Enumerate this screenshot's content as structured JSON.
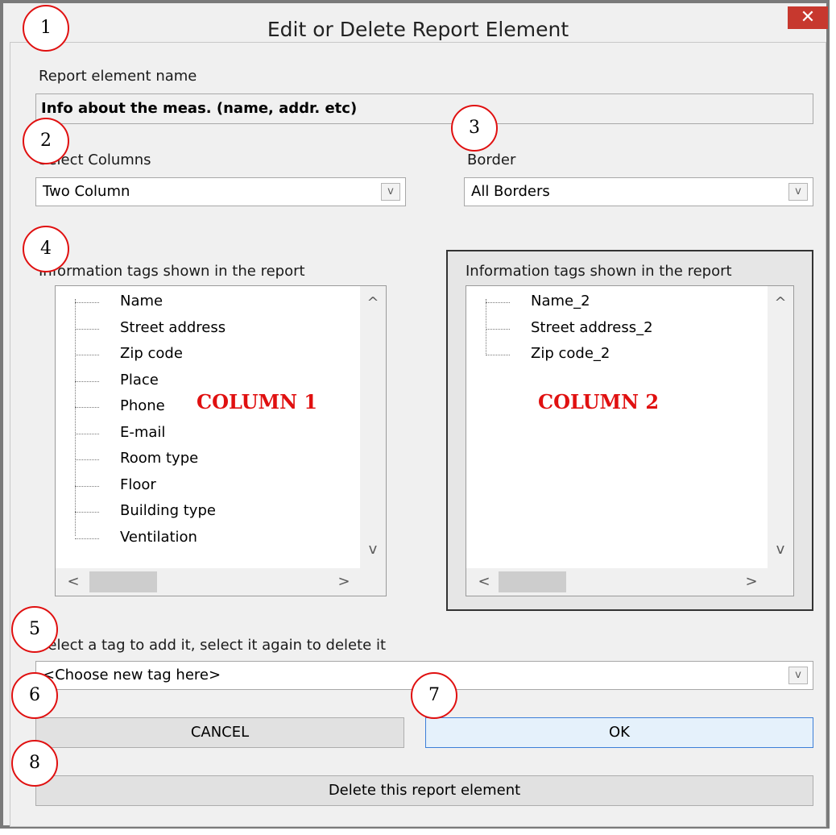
{
  "window": {
    "title": "Edit or Delete Report Element",
    "close_glyph": "✕"
  },
  "report_name": {
    "label": "Report element name",
    "value": "Info about the meas. (name, addr. etc)"
  },
  "columns": {
    "label": "Select Columns",
    "value": "Two Column"
  },
  "border": {
    "label": "Border",
    "value": "All Borders"
  },
  "list1": {
    "label": "Information tags shown in the report",
    "items": [
      "Name",
      "Street address",
      "Zip code",
      "Place",
      "Phone",
      "E-mail",
      "Room type",
      "Floor",
      "Building type",
      "Ventilation"
    ],
    "column_marker": "COLUMN 1"
  },
  "list2": {
    "label": "Information tags shown in the report",
    "items": [
      "Name_2",
      "Street address_2",
      "Zip code_2"
    ],
    "column_marker": "COLUMN 2"
  },
  "add_tag": {
    "label": "Select a tag to add it, select it again to delete it",
    "value": "<Choose new tag here>"
  },
  "buttons": {
    "cancel": "CANCEL",
    "ok": "OK",
    "delete": "Delete this report element"
  },
  "scroll": {
    "up": "^",
    "down": "v",
    "left": "<",
    "right": ">"
  },
  "combo_arrow": "v",
  "callouts": [
    "1",
    "2",
    "3",
    "4",
    "5",
    "6",
    "7",
    "8"
  ]
}
